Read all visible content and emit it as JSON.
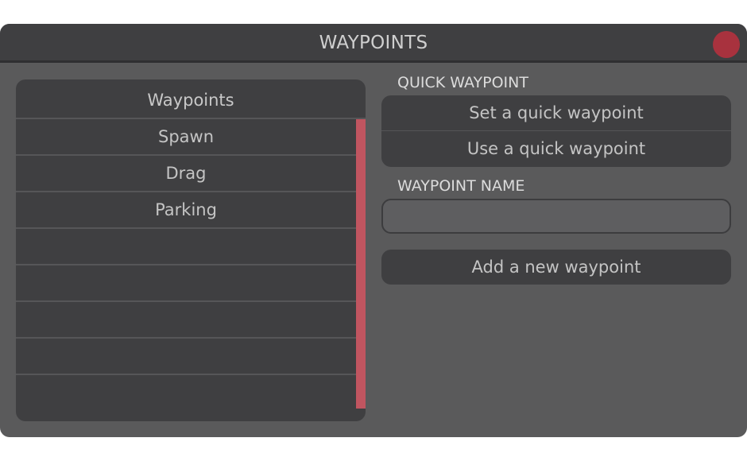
{
  "window": {
    "title": "WAYPOINTS"
  },
  "list": {
    "header": "Waypoints",
    "items": [
      "Spawn",
      "Drag",
      "Parking",
      "",
      "",
      "",
      "",
      ""
    ]
  },
  "quick": {
    "label": "QUICK WAYPOINT",
    "set_label": "Set a quick waypoint",
    "use_label": "Use a quick waypoint"
  },
  "name": {
    "label": "WAYPOINT NAME",
    "value": "",
    "placeholder": ""
  },
  "add": {
    "label": "Add a new waypoint"
  },
  "colors": {
    "background": "#5a5a5b",
    "panel": "#3f3f41",
    "close": "#a8323e",
    "scrollbar": "#c05560"
  },
  "icons": {
    "close": "close-icon"
  }
}
